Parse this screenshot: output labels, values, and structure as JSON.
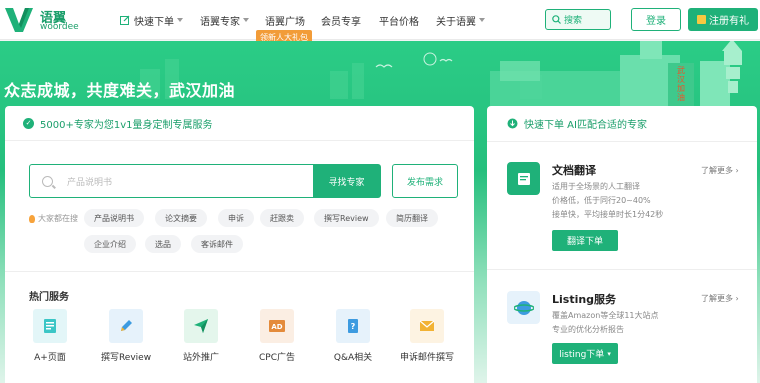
{
  "header": {
    "logo_cn": "语翼",
    "logo_en": "woordee",
    "nav": [
      {
        "label": "快速下单",
        "dropdown": true
      },
      {
        "label": "语翼专家",
        "dropdown": true
      },
      {
        "label": "语翼广场",
        "dropdown": false
      },
      {
        "label": "会员专享",
        "dropdown": false
      },
      {
        "label": "平台价格",
        "dropdown": false
      },
      {
        "label": "关于语翼",
        "dropdown": true
      }
    ],
    "promo_badge": "领新人大礼包",
    "search_label": "搜索",
    "login_label": "登录",
    "register_label": "注册有礼"
  },
  "banner": {
    "title": "众志成城，共度难关，武汉加油",
    "building_text": "武汉加油"
  },
  "left_card": {
    "heading": "5000+专家为您1v1量身定制专属服务",
    "search_placeholder": "产品说明书",
    "find_expert_label": "寻找专家",
    "post_demand_label": "发布需求",
    "hot_search_label": "大家都在搜",
    "tags": [
      "产品说明书",
      "论文摘要",
      "申诉",
      "赶跟卖",
      "撰写Review",
      "简历翻译",
      "企业介绍",
      "选品",
      "客诉邮件"
    ],
    "hot_services_title": "热门服务",
    "services": [
      {
        "label": "A+页面",
        "icon": "a-plus-page-icon",
        "bg": "#e3f6f8",
        "fg": "#3bc6c6"
      },
      {
        "label": "撰写Review",
        "icon": "pencil-icon",
        "bg": "#e6f2fb",
        "fg": "#3d9be0"
      },
      {
        "label": "站外推广",
        "icon": "paper-plane-icon",
        "bg": "#e4f6ec",
        "fg": "#1fb179"
      },
      {
        "label": "CPC广告",
        "icon": "ad-icon",
        "bg": "#fbeee3",
        "fg": "#e48b3b"
      },
      {
        "label": "Q&A相关",
        "icon": "question-book-icon",
        "bg": "#e6f2fb",
        "fg": "#3d9be0"
      },
      {
        "label": "申诉邮件撰写",
        "icon": "envelope-icon",
        "bg": "#fdf3e2",
        "fg": "#f2b233"
      }
    ]
  },
  "right_card": {
    "heading": "快速下单 AI匹配合适的专家",
    "items": [
      {
        "title": "文档翻译",
        "desc": [
          "适用于全场景的人工翻译",
          "价格低，低于同行20~40%",
          "接单快，平均接单时长1分42秒"
        ],
        "more": "了解更多",
        "button": "翻译下单"
      },
      {
        "title": "Listing服务",
        "desc": [
          "覆盖Amazon等全球11大站点",
          "专业的优化分析报告"
        ],
        "more": "了解更多",
        "button": "listing下单"
      }
    ]
  },
  "colors": {
    "brand": "#1fb179",
    "promo": "#f29c38"
  }
}
